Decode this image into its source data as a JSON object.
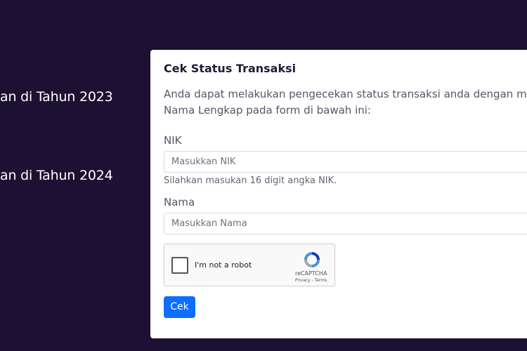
{
  "sidebar": {
    "links": [
      {
        "label": "an di Tahun 2023"
      },
      {
        "label": "an di Tahun 2024"
      }
    ]
  },
  "card": {
    "title": "Cek Status Transaksi",
    "description_line1": "Anda dapat melakukan pengecekan status transaksi anda dengan me",
    "description_line2": "Nama Lengkap pada form di bawah ini:"
  },
  "form": {
    "nik": {
      "label": "NIK",
      "placeholder": "Masukkan NIK",
      "help": "Silahkan masukan 16 digit angka NIK."
    },
    "nama": {
      "label": "Nama",
      "placeholder": "Masukkan Nama"
    },
    "recaptcha": {
      "label": "I'm not a robot",
      "brand": "reCAPTCHA",
      "links": "Privacy - Terms",
      "icon": "recaptcha-logo-icon"
    },
    "submit_label": "Cek"
  },
  "colors": {
    "background": "#1c1033",
    "card": "#ffffff",
    "primary_button": "#0d6efd"
  }
}
